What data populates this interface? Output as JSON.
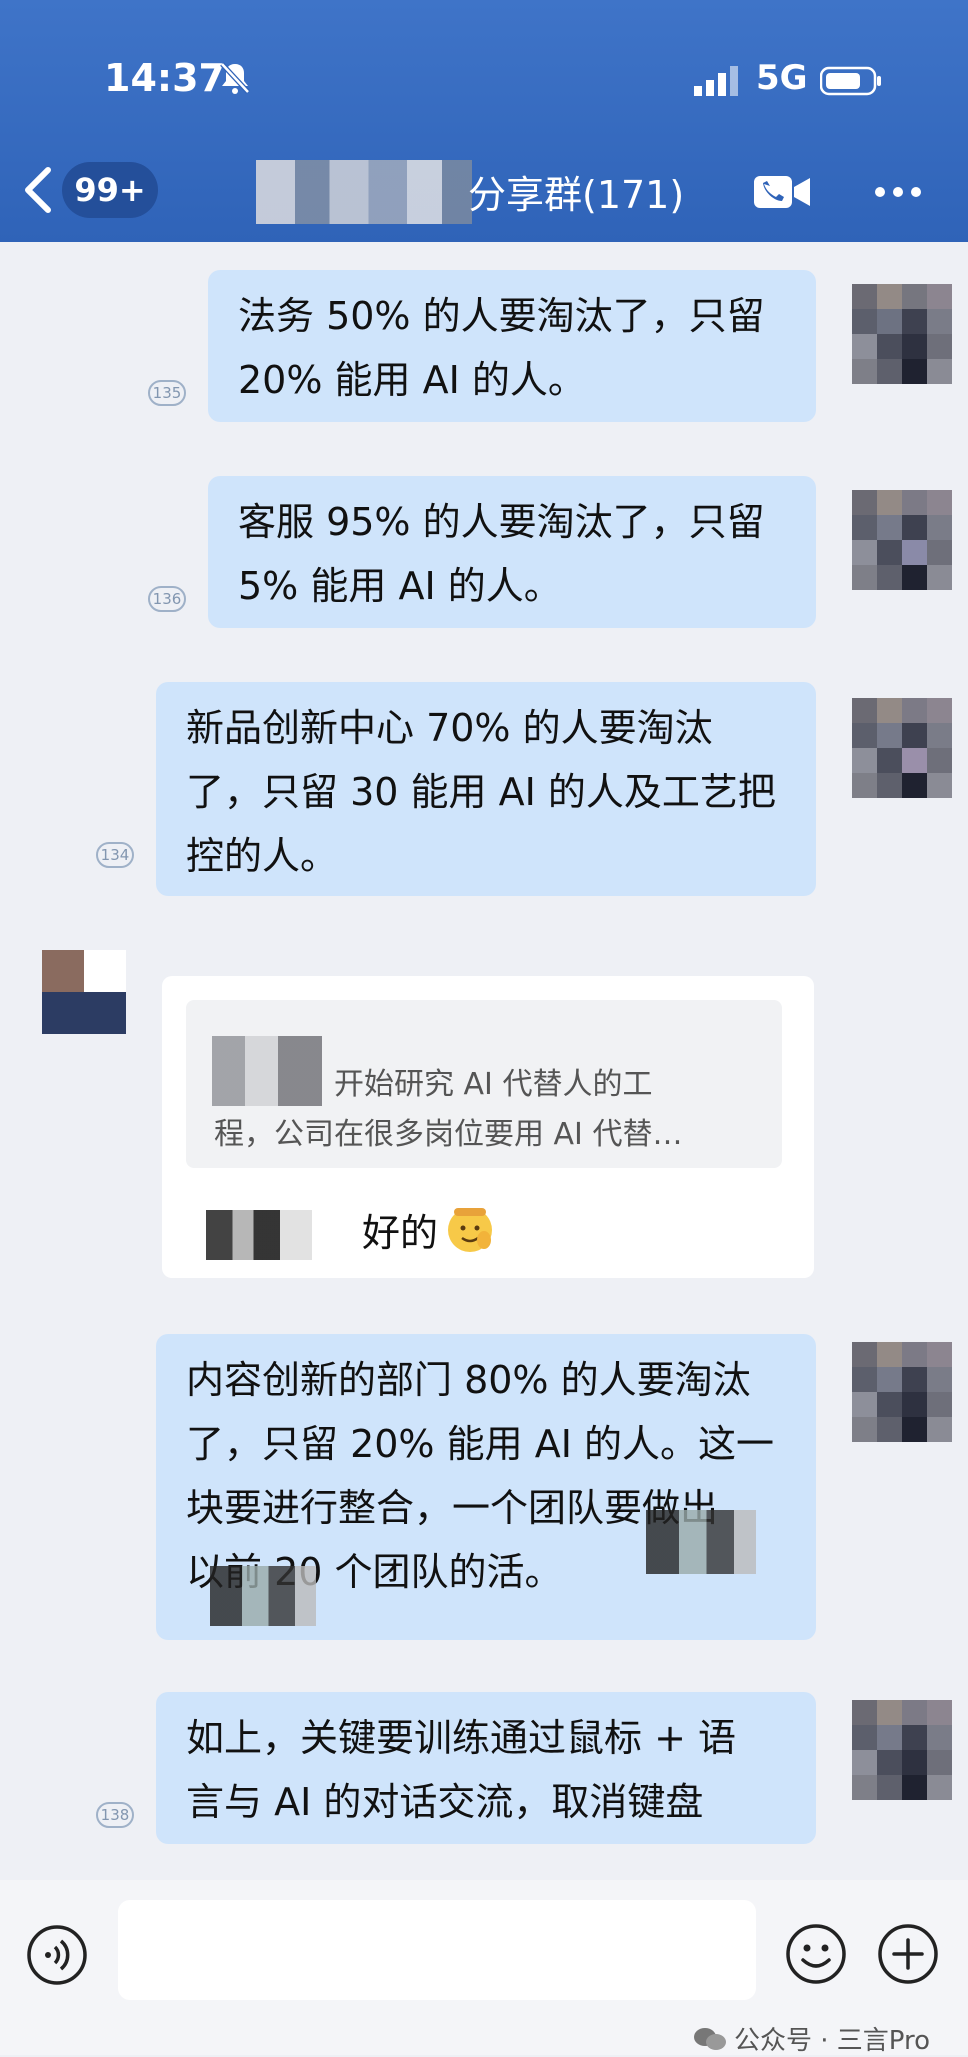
{
  "status_bar": {
    "time": "14:37",
    "network": "5G"
  },
  "header": {
    "unread_badge": "99+",
    "group_name": "分享群(171)"
  },
  "messages": [
    {
      "lines": [
        "法务 50% 的人要淘汰了，只留",
        "20% 能用 AI 的人。"
      ],
      "read_count": "135"
    },
    {
      "lines": [
        "客服 95% 的人要淘汰了，只留",
        "5% 能用 AI 的人。"
      ],
      "read_count": "136"
    },
    {
      "lines": [
        "新品创新中心 70% 的人要淘汰",
        "了，只留 30 能用 AI 的人及工艺把",
        "控的人。"
      ],
      "read_count": "134"
    },
    {
      "lines": [
        "内容创新的部门 80% 的人要淘汰",
        "了，只留 20% 能用 AI 的人。这一",
        "块要进行整合，一个团队要做出",
        "以前 20 个团队的活。"
      ],
      "read_count": ""
    },
    {
      "lines": [
        "如上，关键要训练通过鼠标 + 语",
        "言与 AI 的对话交流，取消键盘"
      ],
      "read_count": "138"
    }
  ],
  "reply": {
    "quote_lines": [
      "开始研究 AI 代替人的工",
      "程，公司在很多岗位要用 AI 代替…"
    ],
    "text": "好的"
  },
  "input": {
    "placeholder": ""
  },
  "watermark": "公众号 · 三言Pro",
  "colors": {
    "header": "#2f63b8",
    "bubble": "#cfe4fb",
    "chat_bg": "#eef0f5"
  }
}
